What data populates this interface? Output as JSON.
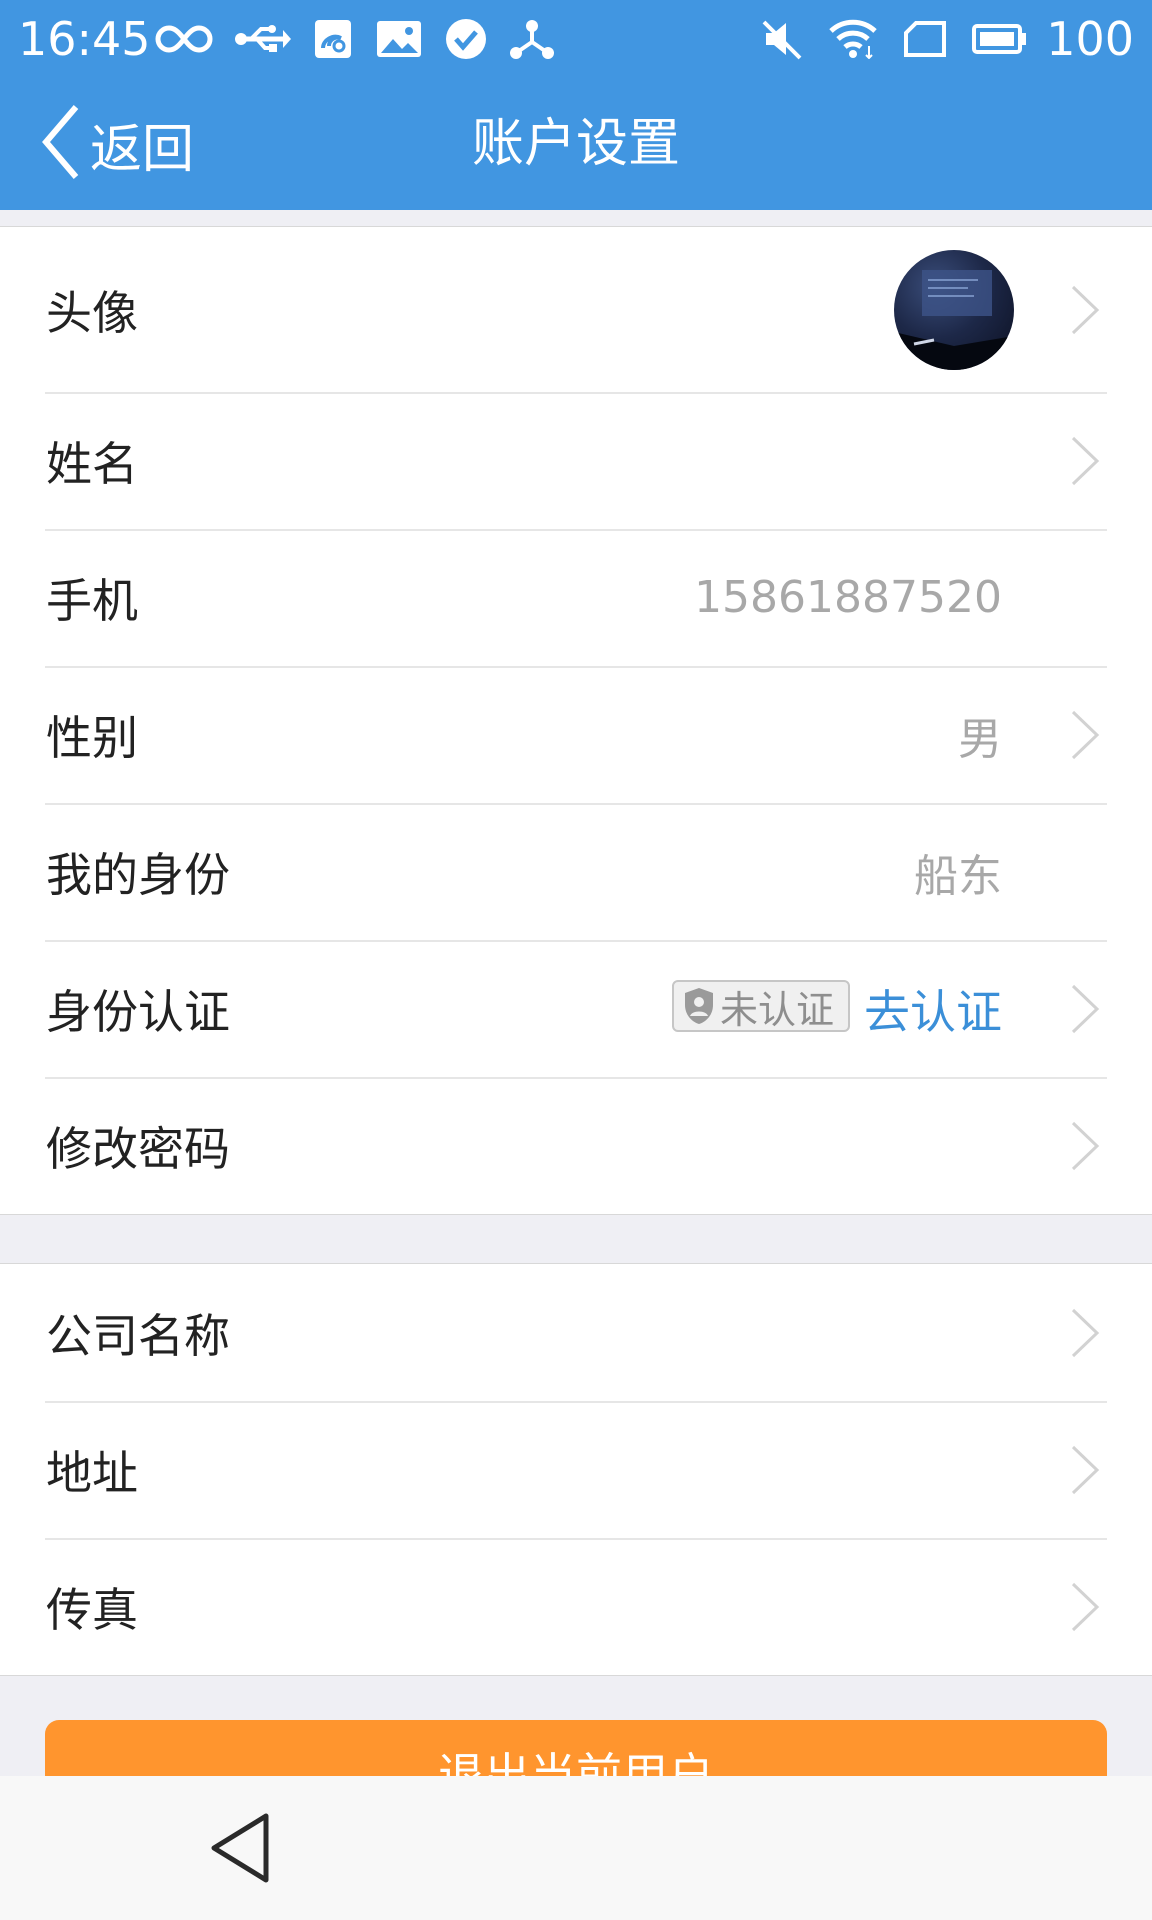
{
  "status_bar": {
    "time": "16:45",
    "left_icons": [
      "infinity-icon",
      "usb-icon",
      "uc-browser-icon",
      "image-icon",
      "check-circle-icon",
      "share-nodes-icon"
    ],
    "right_icons": [
      "mute-icon",
      "wifi-icon",
      "sim-icon",
      "battery-icon"
    ],
    "battery": "100"
  },
  "nav": {
    "back_label": "返回",
    "title": "账户设置"
  },
  "profile_group": {
    "rows": [
      {
        "label": "头像",
        "value": ""
      },
      {
        "label": "姓名",
        "value": ""
      },
      {
        "label": "手机",
        "value": "15861887520"
      },
      {
        "label": "性别",
        "value": "男"
      },
      {
        "label": "我的身份",
        "value": "船东"
      },
      {
        "label": "身份认证",
        "badge": "未认证",
        "action": "去认证"
      },
      {
        "label": "修改密码",
        "value": ""
      }
    ]
  },
  "company_group": {
    "rows": [
      {
        "label": "公司名称"
      },
      {
        "label": "地址"
      },
      {
        "label": "传真"
      }
    ]
  },
  "logout_button": "退出当前用户",
  "colors": {
    "header": "#4196e1",
    "accent_link": "#3b8fd8",
    "logout": "#ff952e"
  }
}
